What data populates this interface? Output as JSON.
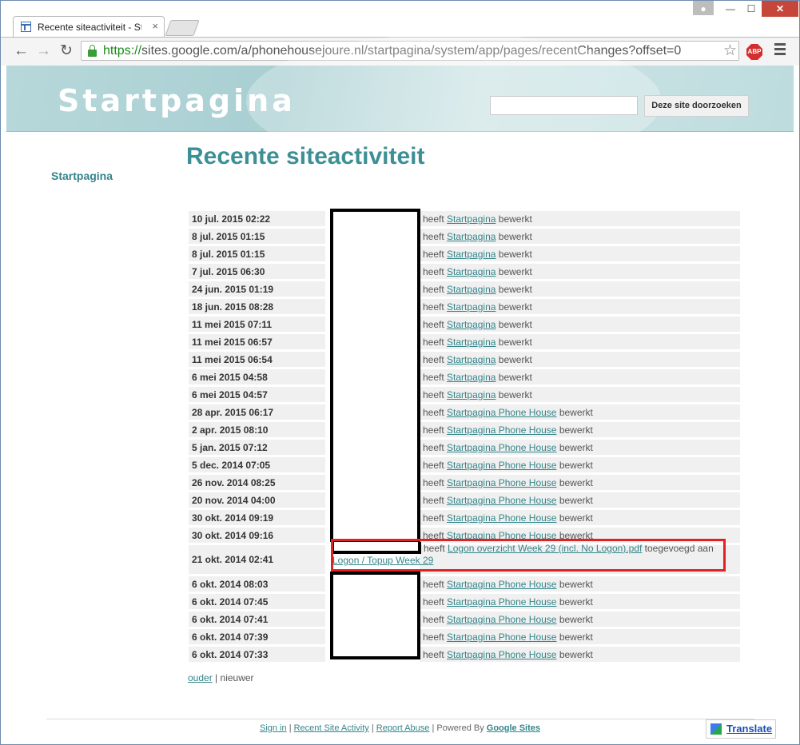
{
  "browser": {
    "tab_title": "Recente siteactiviteit - Sta",
    "url_scheme": "https://",
    "url_rest": "sites.google.com/a/phonehousejoure.nl/startpagina/system/app/pages/recentChanges?offset=0",
    "abp_label": "ABP"
  },
  "header": {
    "site_title": "Startpagina",
    "search_button": "Deze site doorzoeken"
  },
  "sidebar": {
    "items": [
      {
        "label": "Startpagina"
      }
    ]
  },
  "main": {
    "title": "Recente siteactiviteit",
    "rows": [
      {
        "date": "10 jul. 2015 02:22",
        "prefix": "heeft",
        "link": "Startpagina",
        "suffix": "bewerkt"
      },
      {
        "date": "8 jul. 2015 01:15",
        "prefix": "heeft",
        "link": "Startpagina",
        "suffix": "bewerkt"
      },
      {
        "date": "8 jul. 2015 01:15",
        "prefix": "heeft",
        "link": "Startpagina",
        "suffix": "bewerkt"
      },
      {
        "date": "7 jul. 2015 06:30",
        "prefix": "heeft",
        "link": "Startpagina",
        "suffix": "bewerkt"
      },
      {
        "date": "24 jun. 2015 01:19",
        "prefix": "heeft",
        "link": "Startpagina",
        "suffix": "bewerkt"
      },
      {
        "date": "18 jun. 2015 08:28",
        "prefix": "heeft",
        "link": "Startpagina",
        "suffix": "bewerkt"
      },
      {
        "date": "11 mei 2015 07:11",
        "prefix": "heeft",
        "link": "Startpagina",
        "suffix": "bewerkt"
      },
      {
        "date": "11 mei 2015 06:57",
        "prefix": "heeft",
        "link": "Startpagina",
        "suffix": "bewerkt"
      },
      {
        "date": "11 mei 2015 06:54",
        "prefix": "heeft",
        "link": "Startpagina",
        "suffix": "bewerkt"
      },
      {
        "date": "6 mei 2015 04:58",
        "prefix": "heeft",
        "link": "Startpagina",
        "suffix": "bewerkt"
      },
      {
        "date": "6 mei 2015 04:57",
        "prefix": "heeft",
        "link": "Startpagina",
        "suffix": "bewerkt"
      },
      {
        "date": "28 apr. 2015 06:17",
        "prefix": "heeft",
        "link": "Startpagina Phone House",
        "suffix": "bewerkt"
      },
      {
        "date": "2 apr. 2015 08:10",
        "prefix": "heeft",
        "link": "Startpagina Phone House",
        "suffix": "bewerkt"
      },
      {
        "date": "5 jan. 2015 07:12",
        "prefix": "heeft",
        "link": "Startpagina Phone House",
        "suffix": "bewerkt"
      },
      {
        "date": "5 dec. 2014 07:05",
        "prefix": "heeft",
        "link": "Startpagina Phone House",
        "suffix": "bewerkt"
      },
      {
        "date": "26 nov. 2014 08:25",
        "prefix": "heeft",
        "link": "Startpagina Phone House",
        "suffix": "bewerkt"
      },
      {
        "date": "20 nov. 2014 04:00",
        "prefix": "heeft",
        "link": "Startpagina Phone House",
        "suffix": "bewerkt"
      },
      {
        "date": "30 okt. 2014 09:19",
        "prefix": "heeft",
        "link": "Startpagina Phone House",
        "suffix": "bewerkt"
      },
      {
        "date": "30 okt. 2014 09:16",
        "prefix": "heeft",
        "link": "Startpagina Phone House",
        "suffix": "bewerkt"
      }
    ],
    "highlight_row": {
      "date": "21 okt. 2014 02:41",
      "prefix": "heeft",
      "link": "Logon overzicht Week 29 (incl. No Logon).pdf",
      "middle": "toegevoegd aan",
      "link2": "Logon / Topup Week 29"
    },
    "rows_after": [
      {
        "date": "6 okt. 2014 08:03",
        "prefix": "heeft",
        "link": "Startpagina Phone House",
        "suffix": "bewerkt"
      },
      {
        "date": "6 okt. 2014 07:45",
        "prefix": "heeft",
        "link": "Startpagina Phone House",
        "suffix": "bewerkt"
      },
      {
        "date": "6 okt. 2014 07:41",
        "prefix": "heeft",
        "link": "Startpagina Phone House",
        "suffix": "bewerkt"
      },
      {
        "date": "6 okt. 2014 07:39",
        "prefix": "heeft",
        "link": "Startpagina Phone House",
        "suffix": "bewerkt"
      },
      {
        "date": "6 okt. 2014 07:33",
        "prefix": "heeft",
        "link": "Startpagina Phone House",
        "suffix": "bewerkt"
      }
    ],
    "pager": {
      "older": "ouder",
      "separator": "|",
      "newer": "nieuwer"
    }
  },
  "footer": {
    "sign_in": "Sign in",
    "recent_activity": "Recent Site Activity",
    "report_abuse": "Report Abuse",
    "powered_by": "Powered By",
    "google_sites": "Google Sites",
    "sep": "|",
    "translate": "Translate"
  },
  "colors": {
    "accent": "#34858a",
    "highlight": "#e02222",
    "close": "#c7463a"
  }
}
